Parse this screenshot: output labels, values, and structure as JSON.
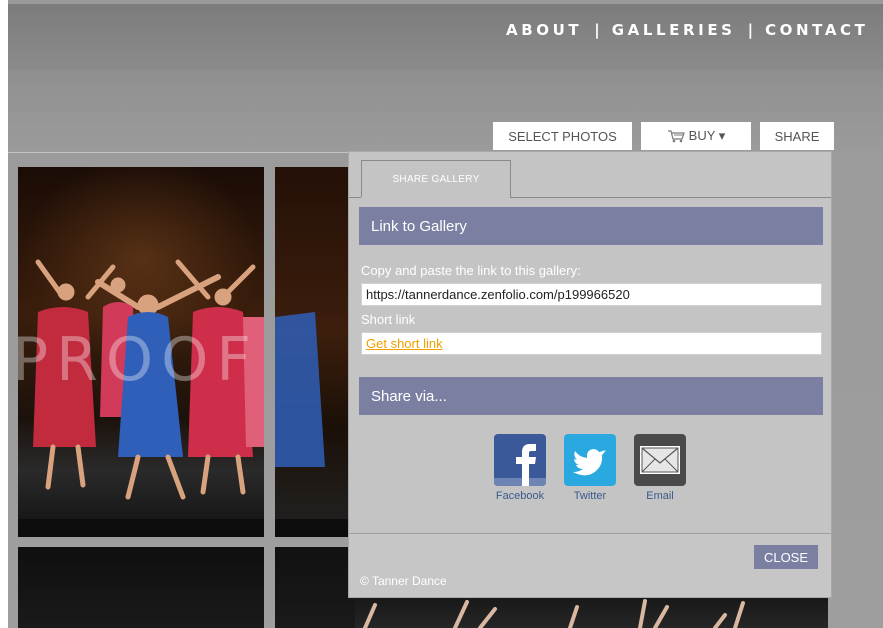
{
  "nav": {
    "items": [
      "ABOUT",
      "GALLERIES",
      "CONTACT"
    ],
    "separator": "|"
  },
  "toolbar": {
    "select_photos": "SELECT PHOTOS",
    "buy": "BUY ▾",
    "share": "SHARE"
  },
  "gallery": {
    "watermark": "PROOF"
  },
  "modal": {
    "tab": "SHARE GALLERY",
    "link_section_title": "Link to Gallery",
    "copy_label": "Copy and paste the link to this gallery:",
    "gallery_url": "https://tannerdance.zenfolio.com/p199966520",
    "short_link_label": "Short link",
    "get_short_link": "Get short link",
    "share_section_title": "Share via...",
    "share_options": [
      {
        "label": "Facebook",
        "icon": "facebook-icon",
        "color": "#3b5998"
      },
      {
        "label": "Twitter",
        "icon": "twitter-icon",
        "color": "#2aa9e0"
      },
      {
        "label": "Email",
        "icon": "email-icon",
        "color": "#4a4a4a"
      }
    ],
    "close": "CLOSE",
    "copyright": "© Tanner Dance"
  },
  "colors": {
    "section_bar": "#7b80a2",
    "link": "#f0a000",
    "share_caption": "#3a5a8c"
  }
}
